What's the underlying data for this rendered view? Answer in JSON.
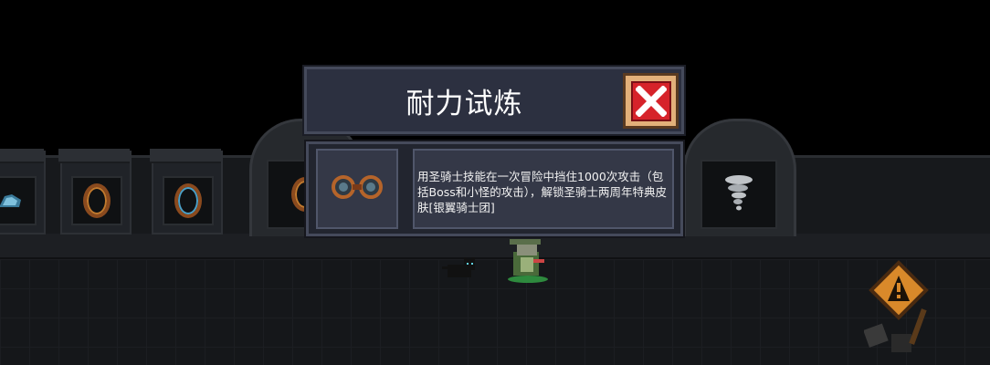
{
  "dialog": {
    "title": "耐力试炼",
    "description": "用圣骑士技能在一次冒险中挡住1000次攻击（包括Boss和小怪的攻击），解锁圣骑士两周年特典皮肤[银翼骑士团]",
    "reward_icon": "goggles-icon",
    "close_icon": "close-x-icon"
  },
  "scene": {
    "pedestal_icons": [
      "blue-gem-item-icon",
      "bronze-ring-item-icon",
      "blue-ring-item-icon"
    ],
    "arch_icons": [
      "bronze-ring-item-icon",
      "tornado-icon"
    ],
    "characters": [
      "black-cat-pet",
      "paladin-hero"
    ],
    "props": [
      "warning-sign"
    ]
  },
  "colors": {
    "panel_bg": "#2c3040",
    "panel_border": "#454a5b",
    "close_red": "#d6232a",
    "close_frame": "#e2b07a"
  }
}
